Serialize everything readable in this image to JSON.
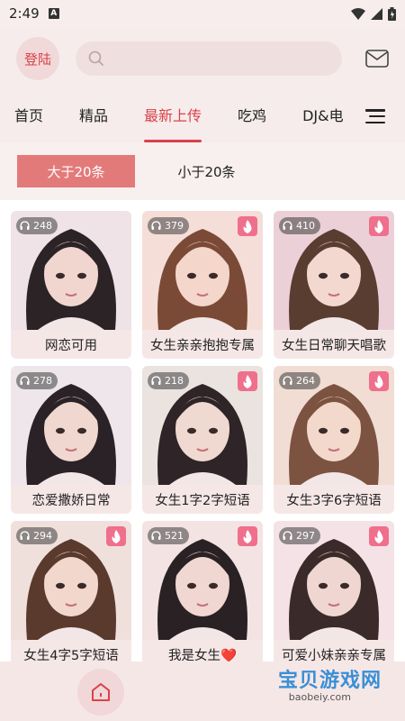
{
  "status": {
    "time": "2:49",
    "notif_icon": "A"
  },
  "header": {
    "login_label": "登陆",
    "search_placeholder": ""
  },
  "tabs": [
    {
      "label": "首页",
      "active": false
    },
    {
      "label": "精品",
      "active": false
    },
    {
      "label": "最新上传",
      "active": true
    },
    {
      "label": "吃鸡",
      "active": false
    },
    {
      "label": "DJ&电",
      "active": false
    }
  ],
  "filters": {
    "left": "大于20条",
    "right": "小于20条"
  },
  "colors": {
    "accent": "#d9424a",
    "filter_active": "#e37a7a",
    "hot_badge": "#ef6f8d"
  },
  "cards": [
    {
      "title": "网恋可用",
      "plays": "248",
      "hot": false,
      "palette": [
        "#efe3e8",
        "#2b2326",
        "#f1d6cf"
      ]
    },
    {
      "title": "女生亲亲抱抱专属",
      "plays": "379",
      "hot": true,
      "palette": [
        "#f5ddd8",
        "#7a4a36",
        "#f4d6cb"
      ]
    },
    {
      "title": "女生日常聊天唱歌",
      "plays": "410",
      "hot": true,
      "palette": [
        "#ecd0d8",
        "#5a3d31",
        "#f3d8cf"
      ]
    },
    {
      "title": "恋爱撒娇日常",
      "plays": "278",
      "hot": false,
      "palette": [
        "#eee6ea",
        "#2a2226",
        "#f0d7d0"
      ]
    },
    {
      "title": "女生1字2字短语",
      "plays": "218",
      "hot": true,
      "palette": [
        "#ebe3e0",
        "#2f2427",
        "#efd9d0"
      ]
    },
    {
      "title": "女生3字6字短语",
      "plays": "264",
      "hot": true,
      "palette": [
        "#f1ddd3",
        "#7c5340",
        "#f3d8cc"
      ]
    },
    {
      "title": "女生4字5字短语",
      "plays": "294",
      "hot": true,
      "palette": [
        "#f0e0dc",
        "#5b3a2e",
        "#f2d7cd"
      ]
    },
    {
      "title": "我是女生❤️",
      "plays": "521",
      "hot": true,
      "palette": [
        "#f3e3e3",
        "#2a2124",
        "#f1d7d2"
      ]
    },
    {
      "title": "可爱小妹亲亲专属",
      "plays": "297",
      "hot": true,
      "palette": [
        "#f4e2e6",
        "#3a2a2a",
        "#f0d6d1"
      ]
    }
  ],
  "watermark": {
    "main": "宝贝游戏网",
    "sub": "baobeiy.com"
  }
}
